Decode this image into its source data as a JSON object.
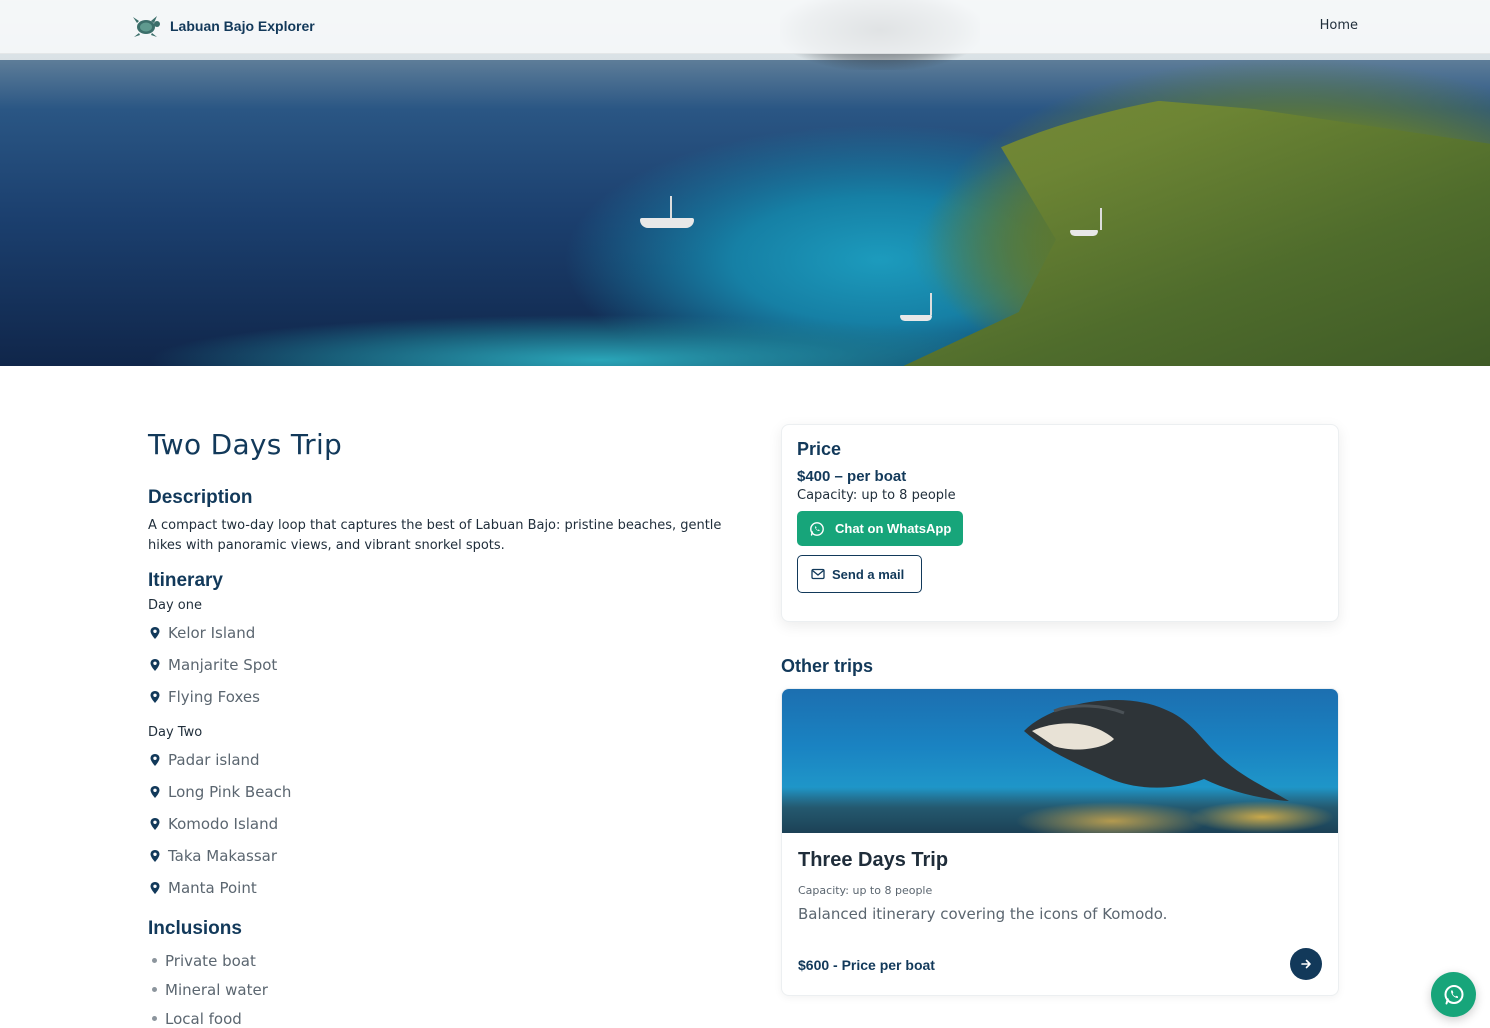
{
  "nav": {
    "brand_name": "Labuan Bajo Explorer",
    "brand_icon": "sea-turtle-icon",
    "links": [
      {
        "label": "Home"
      }
    ]
  },
  "hero": {
    "image": "aerial-bay-with-boats-and-green-hills"
  },
  "trip": {
    "title": "Two Days Trip",
    "description_heading": "Description",
    "description": "A compact two-day loop that captures the best of Labuan Bajo: pristine beaches, gentle hikes with panoramic views, and vibrant snorkel spots.",
    "itinerary_heading": "Itinerary",
    "days": [
      {
        "label": "Day one",
        "stops": [
          "Kelor Island",
          "Manjarite Spot",
          "Flying Foxes"
        ]
      },
      {
        "label": "Day Two",
        "stops": [
          "Padar island",
          "Long Pink Beach",
          "Komodo Island",
          "Taka Makassar",
          "Manta Point"
        ]
      }
    ],
    "inclusions_heading": "Inclusions",
    "inclusions": [
      "Private boat",
      "Mineral water",
      "Local food"
    ]
  },
  "price_card": {
    "heading": "Price",
    "price": "$400 – per boat",
    "capacity": "Capacity: up to 8 people",
    "whatsapp_label": "Chat on WhatsApp",
    "mail_label": "Send a mail"
  },
  "other_trips": {
    "heading": "Other trips",
    "items": [
      {
        "image": "manta-ray-underwater",
        "name": "Three Days Trip",
        "capacity": "Capacity: up to 8 people",
        "description": "Balanced itinerary covering the icons of Komodo.",
        "price": "$600 - Price per boat"
      }
    ]
  },
  "colors": {
    "primary": "#12395a",
    "whatsapp": "#17a57a",
    "muted_text": "#5b6670"
  }
}
